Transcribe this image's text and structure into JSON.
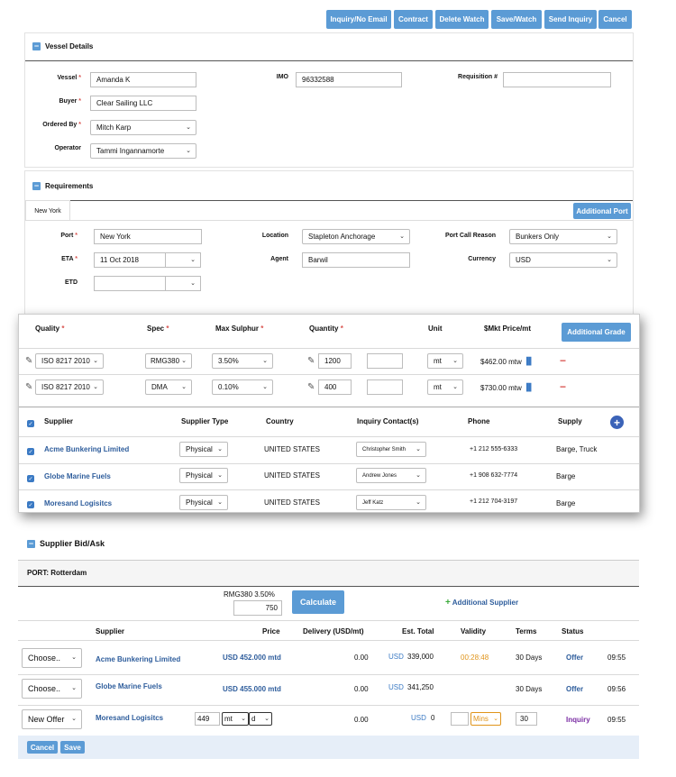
{
  "toolbar": {
    "inquiry_no_email": "Inquiry/No Email",
    "contract": "Contract",
    "delete_watch": "Delete Watch",
    "save_watch": "Save/Watch",
    "send_inquiry": "Send Inquiry",
    "cancel": "Cancel"
  },
  "vessel": {
    "title": "Vessel Details",
    "vessel_label": "Vessel",
    "vessel_value": "Amanda K",
    "imo_label": "IMO",
    "imo_value": "96332588",
    "requisition_label": "Requisition #",
    "requisition_value": "",
    "buyer_label": "Buyer",
    "buyer_value": "Clear Sailing LLC",
    "ordered_by_label": "Ordered By",
    "ordered_by_value": "Mitch Karp",
    "operator_label": "Operator",
    "operator_value": "Tammi Ingannamorte"
  },
  "requirements": {
    "title": "Requirements",
    "tab": "New York",
    "additional_port": "Additional Port",
    "port_label": "Port",
    "port_value": "New York",
    "location_label": "Location",
    "location_value": "Stapleton Anchorage",
    "port_call_label": "Port Call Reason",
    "port_call_value": "Bunkers Only",
    "eta_label": "ETA",
    "eta_value": "11 Oct 2018",
    "agent_label": "Agent",
    "agent_value": "Barwil",
    "currency_label": "Currency",
    "currency_value": "USD",
    "etd_label": "ETD",
    "etd_value": ""
  },
  "grades": {
    "headers": {
      "quality": "Quality",
      "spec": "Spec",
      "max_sulphur": "Max Sulphur",
      "quantity": "Quantity",
      "unit": "Unit",
      "price": "$Mkt Price/mt"
    },
    "additional_grade": "Additional Grade",
    "rows": [
      {
        "quality": "ISO 8217 2010",
        "spec": "RMG380",
        "sulphur": "3.50%",
        "qty": "1200",
        "unit": "mt",
        "price": "$462.00 mtw"
      },
      {
        "quality": "ISO 8217 2010",
        "spec": "DMA",
        "sulphur": "0.10%",
        "qty": "400",
        "unit": "mt",
        "price": "$730.00 mtw"
      }
    ]
  },
  "suppliers": {
    "headers": {
      "supplier": "Supplier",
      "type": "Supplier Type",
      "country": "Country",
      "contact": "Inquiry Contact(s)",
      "phone": "Phone",
      "supply": "Supply"
    },
    "rows": [
      {
        "name": "Acme Bunkering Limited",
        "type": "Physical",
        "country": "UNITED STATES",
        "contact": "Christopher Smith",
        "phone": "+1 212 555-6333",
        "supply": "Barge, Truck"
      },
      {
        "name": "Globe Marine Fuels",
        "type": "Physical",
        "country": "UNITED STATES",
        "contact": "Andrew Jones",
        "phone": "+1 908 632-7774",
        "supply": "Barge"
      },
      {
        "name": "Moresand Logisitcs",
        "type": "Physical",
        "country": "UNITED STATES",
        "contact": "Jeff Katz",
        "phone": "+1 212 704-3197",
        "supply": "Barge"
      }
    ]
  },
  "bids": {
    "title": "Supplier Bid/Ask",
    "port": "PORT: Rotterdam",
    "grade": "RMG380 3.50%",
    "qty": "750",
    "calculate": "Calculate",
    "additional_supplier": "Additional Supplier",
    "headers": {
      "supplier": "Supplier",
      "price": "Price",
      "delivery": "Delivery (USD/mt)",
      "total": "Est. Total",
      "validity": "Validity",
      "terms": "Terms",
      "status": "Status"
    },
    "rows": [
      {
        "action": "Choose..",
        "supplier": "Acme Bunkering Limited",
        "price": "USD 452.000 mtd",
        "delivery": "0.00",
        "cur": "USD",
        "total": "339,000",
        "validity": "00:28:48",
        "terms": "30 Days",
        "status": "Offer",
        "time": "09:55"
      },
      {
        "action": "Choose..",
        "supplier": "Globe Marine Fuels",
        "price": "USD 455.000 mtd",
        "delivery": "0.00",
        "cur": "USD",
        "total": "341,250",
        "validity": "",
        "terms": "30 Days",
        "status": "Offer",
        "time": "09:56"
      },
      {
        "action": "New Offer",
        "supplier": "Moresand Logisitcs",
        "price_input": "449",
        "price_unit": "mt",
        "price_basis": "d",
        "delivery": "0.00",
        "cur": "USD",
        "total": "0",
        "validity_unit": "Mins",
        "terms": "30",
        "status": "Inquiry",
        "time": "09:55"
      }
    ],
    "cancel": "Cancel",
    "save": "Save"
  },
  "colors": {
    "accent": "#5b9bd5",
    "link": "#2e5d9c",
    "status_offer": "#2e5d9c",
    "status_inquiry": "#7a2ca3",
    "validity": "#e0941a",
    "remove": "#d9534f",
    "add": "#3cab3c"
  }
}
